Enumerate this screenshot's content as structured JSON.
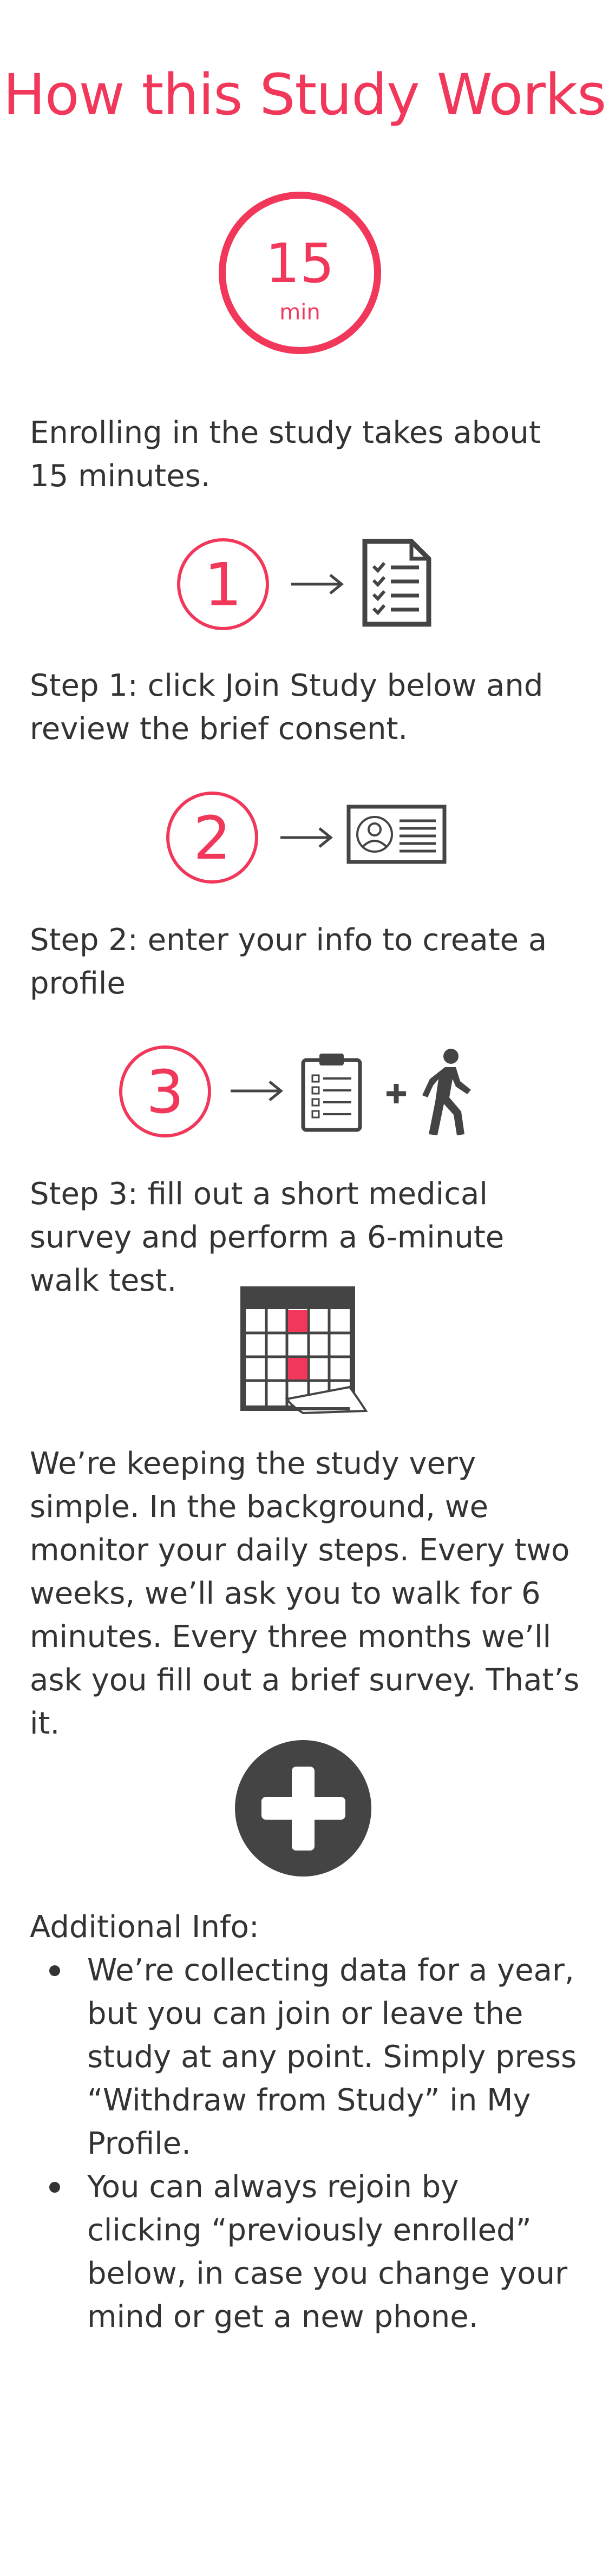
{
  "page": {
    "title": "How this Study Works"
  },
  "timer": {
    "number": "15",
    "unit": "min"
  },
  "intro": "Enrolling in the study takes about 15 minutes.",
  "steps": [
    {
      "number": "1",
      "text": "Step 1: click Join Study below and review the brief consent."
    },
    {
      "number": "2",
      "text": "Step 2: enter your info to create a profile"
    },
    {
      "number": "3",
      "text": "Step 3: fill out a short medical survey and perform a 6-minute walk test."
    }
  ],
  "simple_text": "We’re keeping the study very simple. In the background, we monitor your daily steps. Every two weeks, we’ll ask you to walk for 6 minutes. Every three months we’ll ask you fill out a brief survey. That’s it.",
  "additional": {
    "heading": "Additional Info:",
    "items": [
      "We’re collecting data for a year, but you can join or leave the study at any point. Simply press “Withdraw from Study” in My Profile.",
      "You can always rejoin by clicking “previously enrolled” below, in case you change your mind or get a new phone."
    ]
  },
  "icons": {
    "arrow": "arrow-right-icon",
    "checklist": "checklist-icon",
    "id_card": "id-card-icon",
    "clipboard": "clipboard-survey-icon",
    "plus": "plus-icon",
    "walker": "walking-person-icon",
    "calendar": "calendar-icon",
    "add": "add-circle-icon"
  },
  "colors": {
    "accent": "#f2385a",
    "text": "#333333",
    "icon": "#444444"
  }
}
